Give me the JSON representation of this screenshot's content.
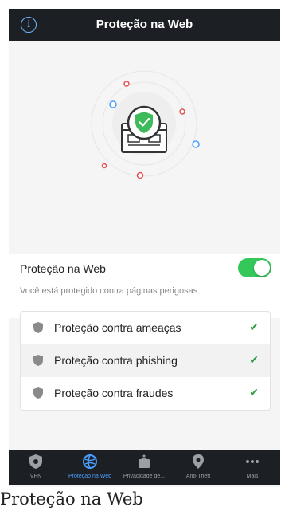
{
  "header": {
    "title": "Proteção na Web",
    "info_icon": "info-icon"
  },
  "protection": {
    "label": "Proteção na Web",
    "enabled": true,
    "description": "Você está protegido contra páginas perigosas."
  },
  "features": [
    {
      "label": "Proteção contra ameaças",
      "icon": "shield-icon",
      "status": "check-icon"
    },
    {
      "label": "Proteção contra phishing",
      "icon": "shield-icon",
      "status": "check-icon"
    },
    {
      "label": "Proteção contra fraudes",
      "icon": "shield-icon",
      "status": "check-icon"
    }
  ],
  "tabs": [
    {
      "label": "VPN",
      "icon": "vpn-icon",
      "active": false
    },
    {
      "label": "Proteção na Web",
      "icon": "web-protection-icon",
      "active": true
    },
    {
      "label": "Privacidade de...",
      "icon": "privacy-icon",
      "active": false
    },
    {
      "label": "Anti-Theft",
      "icon": "anti-theft-icon",
      "active": false
    },
    {
      "label": "Mais",
      "icon": "more-icon",
      "active": false
    }
  ],
  "caption": "Proteção na Web",
  "colors": {
    "accent_green": "#34c759",
    "check_green": "#2e9e48",
    "active_tab": "#4a9eff",
    "dark_bar": "#1c1f24"
  }
}
